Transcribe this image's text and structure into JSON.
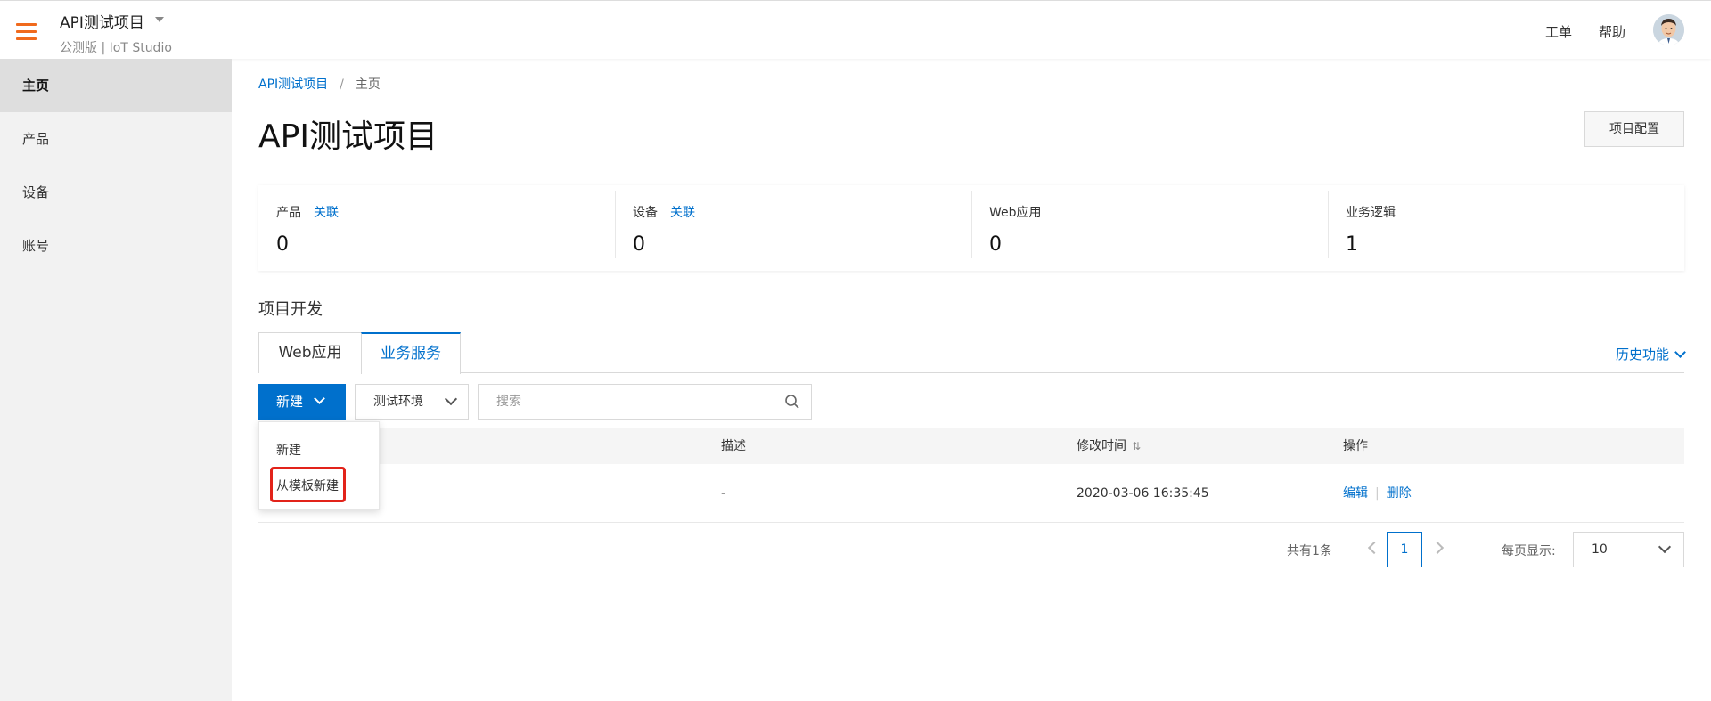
{
  "header": {
    "project_title": "API测试项目",
    "project_subtitle": "公测版 | IoT Studio",
    "ticket_label": "工单",
    "help_label": "帮助",
    "accent_color": "#f06a1d"
  },
  "sidebar": {
    "items": [
      {
        "label": "主页",
        "active": true
      },
      {
        "label": "产品"
      },
      {
        "label": "设备"
      },
      {
        "label": "账号"
      }
    ]
  },
  "breadcrumb": {
    "parent": "API测试项目",
    "separator": "/",
    "current": "主页"
  },
  "page": {
    "title": "API测试项目",
    "config_button": "项目配置"
  },
  "stats": [
    {
      "label": "产品",
      "link": "关联",
      "value": "0"
    },
    {
      "label": "设备",
      "link": "关联",
      "value": "0"
    },
    {
      "label": "Web应用",
      "value": "0"
    },
    {
      "label": "业务逻辑",
      "value": "1"
    }
  ],
  "section": {
    "title": "项目开发",
    "tabs": [
      {
        "label": "Web应用"
      },
      {
        "label": "业务服务",
        "active": true
      }
    ],
    "history_label": "历史功能"
  },
  "toolbar": {
    "new_label": "新建",
    "env_label": "测试环境",
    "search_placeholder": "搜索"
  },
  "dropdown": {
    "items": [
      "新建",
      "从模板新建"
    ],
    "highlighted": "从模板新建"
  },
  "table": {
    "columns": [
      "描述",
      "修改时间",
      "操作"
    ],
    "rows": [
      {
        "desc": "-",
        "modified": "2020-03-06 16:35:45",
        "edit": "编辑",
        "delete": "删除"
      }
    ]
  },
  "pager": {
    "total": "共有1条",
    "current_page": "1",
    "per_page_label": "每页显示:",
    "per_page_value": "10"
  },
  "colors": {
    "primary": "#0070cc",
    "highlight": "#e2231a"
  }
}
